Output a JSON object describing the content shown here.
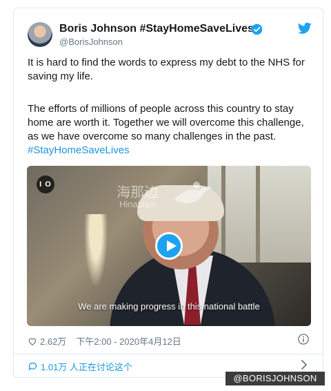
{
  "author": {
    "display_name": "Boris Johnson #StayHomeSaveLives",
    "handle": "@BorisJohnson",
    "verified": true
  },
  "tweet": {
    "paragraph1": "It is hard to find the words to express my debt to the NHS for saving my life.",
    "paragraph2": "The efforts of millions of people across this country to stay home are worth it. Together we will overcome this challenge, as we have overcome so many challenges in the past.",
    "hashtag": "#StayHomeSaveLives"
  },
  "media": {
    "loop_badge": "I O",
    "watermark_cn": "海那边",
    "watermark_en": "Hinabian",
    "caption": "We are making progress in this national battle"
  },
  "meta": {
    "likes": "2.62万",
    "timestamp": "下午2:00 - 2020年4月12日"
  },
  "replies": {
    "label": "1.01万 人正在讨论这个"
  },
  "credit": "@BORISJOHNSON",
  "colors": {
    "accent": "#1da1f2",
    "link": "#1b95e0",
    "muted": "#657786"
  }
}
